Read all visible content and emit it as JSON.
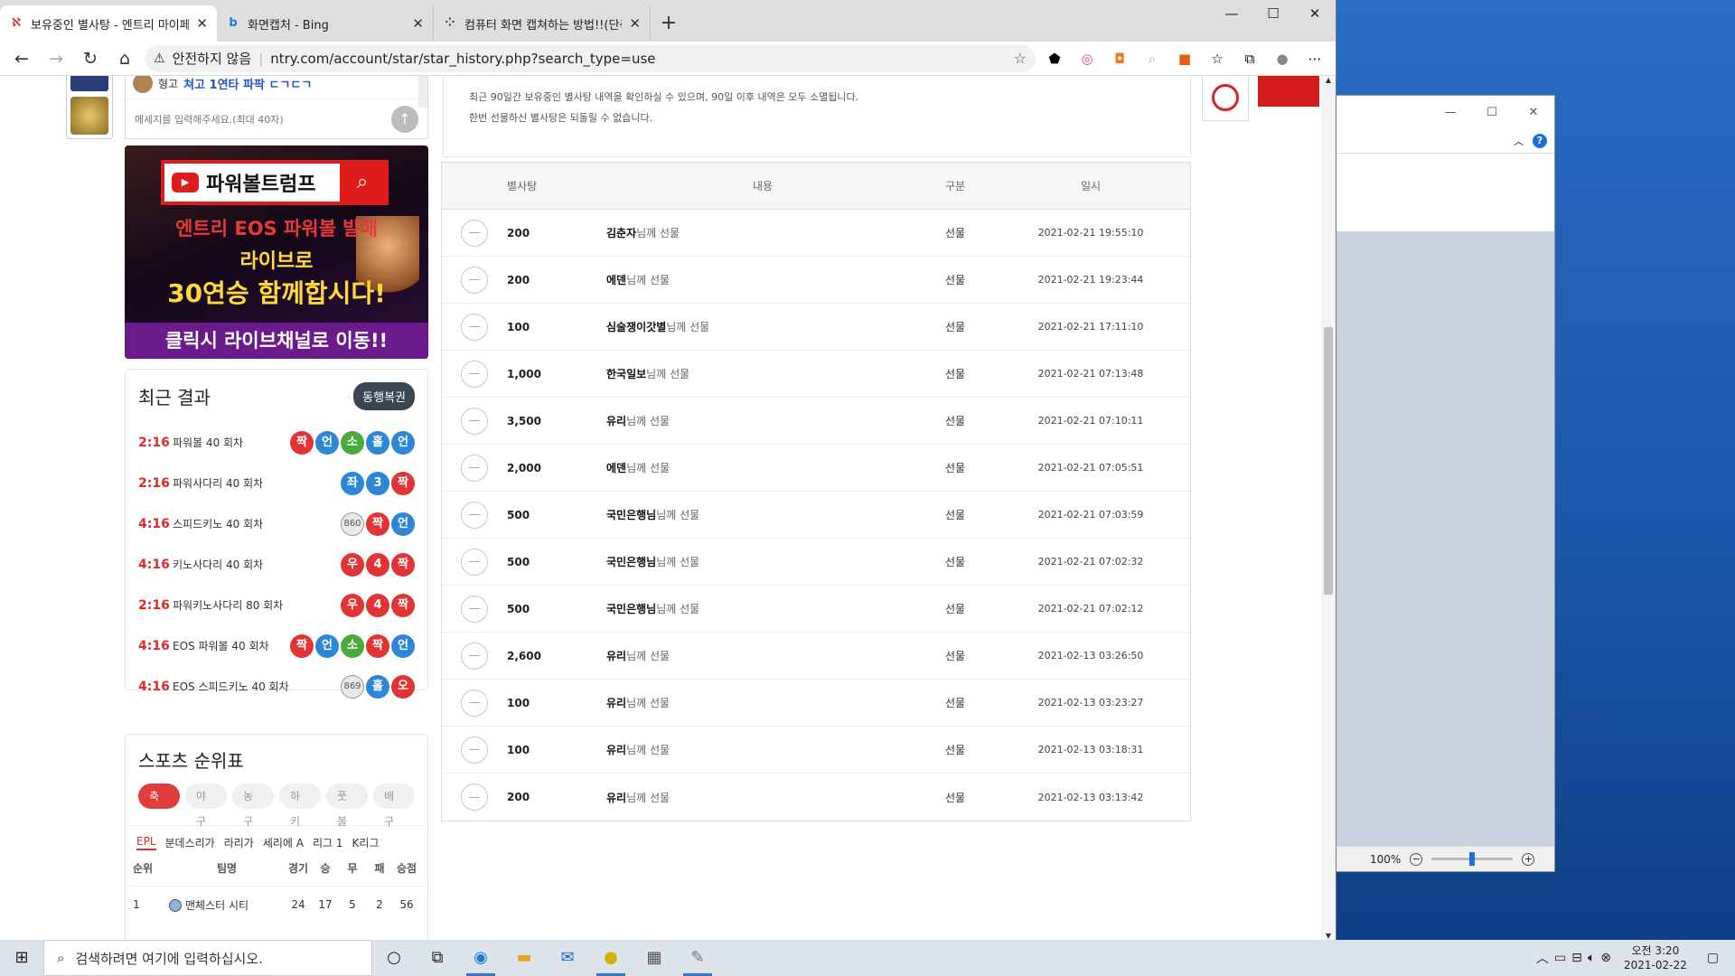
{
  "browser": {
    "tabs": [
      {
        "title": "보유중인 별사탕 - 엔트리 마이페",
        "favicon": "entry-icon",
        "active": true
      },
      {
        "title": "화면캡처 - Bing",
        "favicon": "bing-icon",
        "active": false
      },
      {
        "title": "컴퓨터 화면 캡쳐하는 방법!!(단축",
        "favicon": "blog-icon",
        "active": false
      }
    ],
    "security_label": "안전하지 않음",
    "url": "ntry.com/account/star/star_history.php?search_type=use"
  },
  "chat": {
    "label": "형고",
    "message": "쳐고 1연타 파팍 ㄷㄱㄷㄱ",
    "placeholder": "메세지를 입력해주세요.(최대 40자)"
  },
  "banner": {
    "brand": "파워볼트럼프",
    "line1": "엔트리 EOS 파워볼 발매",
    "line2": "라이브로",
    "line3": "30연승 함께합시다!",
    "cta": "클릭시 라이브채널로 이동!!"
  },
  "recent": {
    "title": "최근 결과",
    "button": "동행복권",
    "rows": [
      {
        "time": "2:16",
        "game": "파워볼 40 회차",
        "balls": [
          {
            "t": "짝",
            "c": "r"
          },
          {
            "t": "언",
            "c": "b"
          },
          {
            "t": "소",
            "c": "g"
          },
          {
            "t": "홀",
            "c": "b"
          },
          {
            "t": "언",
            "c": "b"
          }
        ]
      },
      {
        "time": "2:16",
        "game": "파워사다리 40 회차",
        "balls": [
          {
            "t": "좌",
            "c": "b"
          },
          {
            "t": "3",
            "c": "b"
          },
          {
            "t": "짝",
            "c": "r"
          }
        ]
      },
      {
        "time": "4:16",
        "game": "스피드키노 40 회차",
        "balls": [
          {
            "t": "860",
            "c": "n"
          },
          {
            "t": "짝",
            "c": "r"
          },
          {
            "t": "언",
            "c": "b"
          }
        ]
      },
      {
        "time": "4:16",
        "game": "키노사다리 40 회차",
        "balls": [
          {
            "t": "우",
            "c": "r"
          },
          {
            "t": "4",
            "c": "r"
          },
          {
            "t": "짝",
            "c": "r"
          }
        ]
      },
      {
        "time": "2:16",
        "game": "파워키노사다리 80 회차",
        "balls": [
          {
            "t": "우",
            "c": "r"
          },
          {
            "t": "4",
            "c": "r"
          },
          {
            "t": "짝",
            "c": "r"
          }
        ]
      },
      {
        "time": "4:16",
        "game": "EOS 파워볼 40 회차",
        "balls": [
          {
            "t": "짝",
            "c": "r"
          },
          {
            "t": "언",
            "c": "b"
          },
          {
            "t": "소",
            "c": "g"
          },
          {
            "t": "짝",
            "c": "r"
          },
          {
            "t": "언",
            "c": "b"
          }
        ]
      },
      {
        "time": "4:16",
        "game": "EOS 스피드키노 40 회차",
        "balls": [
          {
            "t": "869",
            "c": "n"
          },
          {
            "t": "홀",
            "c": "b"
          },
          {
            "t": "오",
            "c": "r"
          }
        ]
      }
    ]
  },
  "sports": {
    "title": "스포츠 순위표",
    "tabs": [
      "축구",
      "야구",
      "농구",
      "하키",
      "풋볼",
      "배구"
    ],
    "leagues": [
      "EPL",
      "분데스리가",
      "라리가",
      "세리에 A",
      "리그 1",
      "K리그"
    ],
    "headers": [
      "순위",
      "팀명",
      "경기",
      "승",
      "무",
      "패",
      "승점"
    ],
    "rows": [
      {
        "rank": "1",
        "team": "맨체스터 시티",
        "played": "24",
        "w": "17",
        "d": "5",
        "l": "2",
        "pts": "56"
      }
    ]
  },
  "notice": {
    "line1": "최근 90일간 보유중인 별사탕 내역을 확인하실 수 있으며, 90일 이후 내역은 모두 소멸됩니다.",
    "line2": "한번 선물하신 별사탕은 되돌릴 수 없습니다."
  },
  "history": {
    "headers": {
      "amount": "별사탕",
      "desc": "내용",
      "type": "구분",
      "date": "일시"
    },
    "rows": [
      {
        "amount": "200",
        "nick": "김춘자",
        "suffix": "님께 선물",
        "type": "선물",
        "date": "2021-02-21 19:55:10"
      },
      {
        "amount": "200",
        "nick": "에덴",
        "suffix": "님께 선물",
        "type": "선물",
        "date": "2021-02-21 19:23:44"
      },
      {
        "amount": "100",
        "nick": "심술쟁이갓별",
        "suffix": "님께 선물",
        "type": "선물",
        "date": "2021-02-21 17:11:10"
      },
      {
        "amount": "1,000",
        "nick": "한국일보",
        "suffix": "님께 선물",
        "type": "선물",
        "date": "2021-02-21 07:13:48"
      },
      {
        "amount": "3,500",
        "nick": "유리",
        "suffix": "님께 선물",
        "type": "선물",
        "date": "2021-02-21 07:10:11"
      },
      {
        "amount": "2,000",
        "nick": "에덴",
        "suffix": "님께 선물",
        "type": "선물",
        "date": "2021-02-21 07:05:51"
      },
      {
        "amount": "500",
        "nick": "국민은행님",
        "suffix": "님께 선물",
        "type": "선물",
        "date": "2021-02-21 07:03:59"
      },
      {
        "amount": "500",
        "nick": "국민은행님",
        "suffix": "님께 선물",
        "type": "선물",
        "date": "2021-02-21 07:02:32"
      },
      {
        "amount": "500",
        "nick": "국민은행님",
        "suffix": "님께 선물",
        "type": "선물",
        "date": "2021-02-21 07:02:12"
      },
      {
        "amount": "2,600",
        "nick": "유리",
        "suffix": "님께 선물",
        "type": "선물",
        "date": "2021-02-13 03:26:50"
      },
      {
        "amount": "100",
        "nick": "유리",
        "suffix": "님께 선물",
        "type": "선물",
        "date": "2021-02-13 03:23:27"
      },
      {
        "amount": "100",
        "nick": "유리",
        "suffix": "님께 선물",
        "type": "선물",
        "date": "2021-02-13 03:18:31"
      },
      {
        "amount": "200",
        "nick": "유리",
        "suffix": "님께 선물",
        "type": "선물",
        "date": "2021-02-13 03:13:42"
      }
    ]
  },
  "bgwindow": {
    "zoom": "100%"
  },
  "taskbar": {
    "search_placeholder": "검색하려면 여기에 입력하십시오.",
    "time": "오전 3:20",
    "date": "2021-02-22"
  }
}
